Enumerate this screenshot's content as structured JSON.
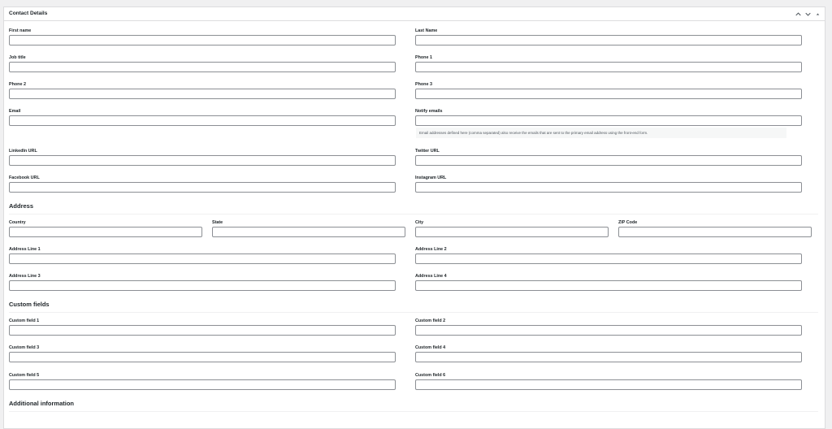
{
  "panel": {
    "title": "Contact Details"
  },
  "fields": {
    "first_name": {
      "label": "First name",
      "value": ""
    },
    "last_name": {
      "label": "Last Name",
      "value": ""
    },
    "job_title": {
      "label": "Job title",
      "value": ""
    },
    "phone1": {
      "label": "Phone 1",
      "value": ""
    },
    "phone2": {
      "label": "Phone 2",
      "value": ""
    },
    "phone3": {
      "label": "Phone 3",
      "value": ""
    },
    "email": {
      "label": "Email",
      "value": ""
    },
    "notify_emails": {
      "label": "Notify emails",
      "value": "",
      "help": "Email addresses defined here (comma separated) also receive the emails that are sent to the primary email address using the front-end form."
    },
    "linkedin": {
      "label": "LinkedIn URL",
      "value": ""
    },
    "twitter": {
      "label": "Twitter URL",
      "value": ""
    },
    "facebook": {
      "label": "Facebook URL",
      "value": ""
    },
    "instagram": {
      "label": "Instagram URL",
      "value": ""
    }
  },
  "address": {
    "heading": "Address",
    "country": {
      "label": "Country",
      "value": ""
    },
    "state": {
      "label": "State",
      "value": ""
    },
    "city": {
      "label": "City",
      "value": ""
    },
    "zip": {
      "label": "ZIP Code",
      "value": ""
    },
    "line1": {
      "label": "Address Line 1",
      "value": ""
    },
    "line2": {
      "label": "Address Line 2",
      "value": ""
    },
    "line3": {
      "label": "Address Line 3",
      "value": ""
    },
    "line4": {
      "label": "Address Line 4",
      "value": ""
    }
  },
  "custom": {
    "heading": "Custom fields",
    "f1": {
      "label": "Custom field 1",
      "value": ""
    },
    "f2": {
      "label": "Custom field 2",
      "value": ""
    },
    "f3": {
      "label": "Custom field 3",
      "value": ""
    },
    "f4": {
      "label": "Custom field 4",
      "value": ""
    },
    "f5": {
      "label": "Custom field 5",
      "value": ""
    },
    "f6": {
      "label": "Custom field 6",
      "value": ""
    }
  },
  "additional": {
    "heading": "Additional information"
  },
  "icons": {
    "move_up": "chevron-up-icon",
    "move_down": "chevron-down-icon",
    "toggle": "triangle-up-icon"
  }
}
